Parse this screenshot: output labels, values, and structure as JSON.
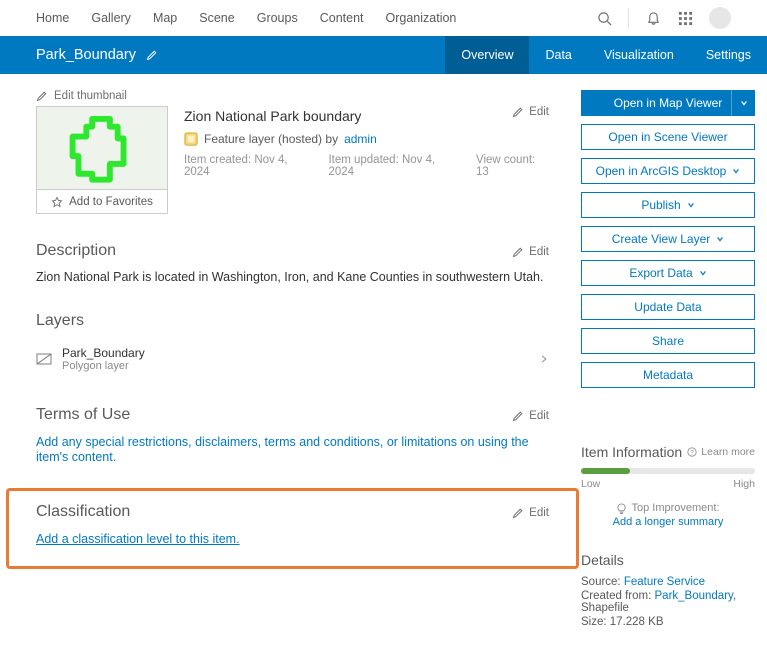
{
  "topnav": {
    "links": [
      "Home",
      "Gallery",
      "Map",
      "Scene",
      "Groups",
      "Content",
      "Organization"
    ]
  },
  "item": {
    "banner_title": "Park_Boundary",
    "tabs": [
      {
        "label": "Overview",
        "active": true
      },
      {
        "label": "Data",
        "active": false
      },
      {
        "label": "Visualization",
        "active": false
      },
      {
        "label": "Settings",
        "active": false
      }
    ],
    "title": "Zion National Park boundary",
    "type": "Feature layer (hosted) by",
    "owner": "admin",
    "created_label": "Item created:",
    "created": "Nov 4, 2024",
    "updated_label": "Item updated:",
    "updated": "Nov 4, 2024",
    "views_label": "View count:",
    "views": "13"
  },
  "thumbnail": {
    "edit_label": "Edit thumbnail",
    "favorites": "Add to Favorites"
  },
  "sections": {
    "description": {
      "heading": "Description",
      "text": "Zion National Park is located in Washington, Iron, and Kane Counties in southwestern Utah."
    },
    "layers": {
      "heading": "Layers",
      "items": [
        {
          "name": "Park_Boundary",
          "subtype": "Polygon layer"
        }
      ]
    },
    "terms": {
      "heading": "Terms of Use",
      "prompt": "Add any special restrictions, disclaimers, terms and conditions, or limitations on using the item's content."
    },
    "classification": {
      "heading": "Classification",
      "prompt": "Add a classification level to this item."
    }
  },
  "edit_label": "Edit",
  "sidebar": {
    "primary": "Open in Map Viewer",
    "buttons": [
      {
        "label": "Open in Scene Viewer",
        "dropdown": false
      },
      {
        "label": "Open in ArcGIS Desktop",
        "dropdown": true
      },
      {
        "label": "Publish",
        "dropdown": true
      },
      {
        "label": "Create View Layer",
        "dropdown": true
      },
      {
        "label": "Export Data",
        "dropdown": true
      },
      {
        "label": "Update Data",
        "dropdown": false
      },
      {
        "label": "Share",
        "dropdown": false
      },
      {
        "label": "Metadata",
        "dropdown": false
      }
    ]
  },
  "info": {
    "heading": "Item Information",
    "learn_more": "Learn more",
    "low": "Low",
    "high": "High",
    "top_improvement": "Top Improvement:",
    "suggestion": "Add a longer summary"
  },
  "details": {
    "heading": "Details",
    "source_label": "Source:",
    "source": "Feature Service",
    "created_from_label": "Created from:",
    "created_from": "Park_Boundary",
    "created_from_suffix": ", Shapefile",
    "size_label": "Size:",
    "size": "17.228 KB"
  }
}
